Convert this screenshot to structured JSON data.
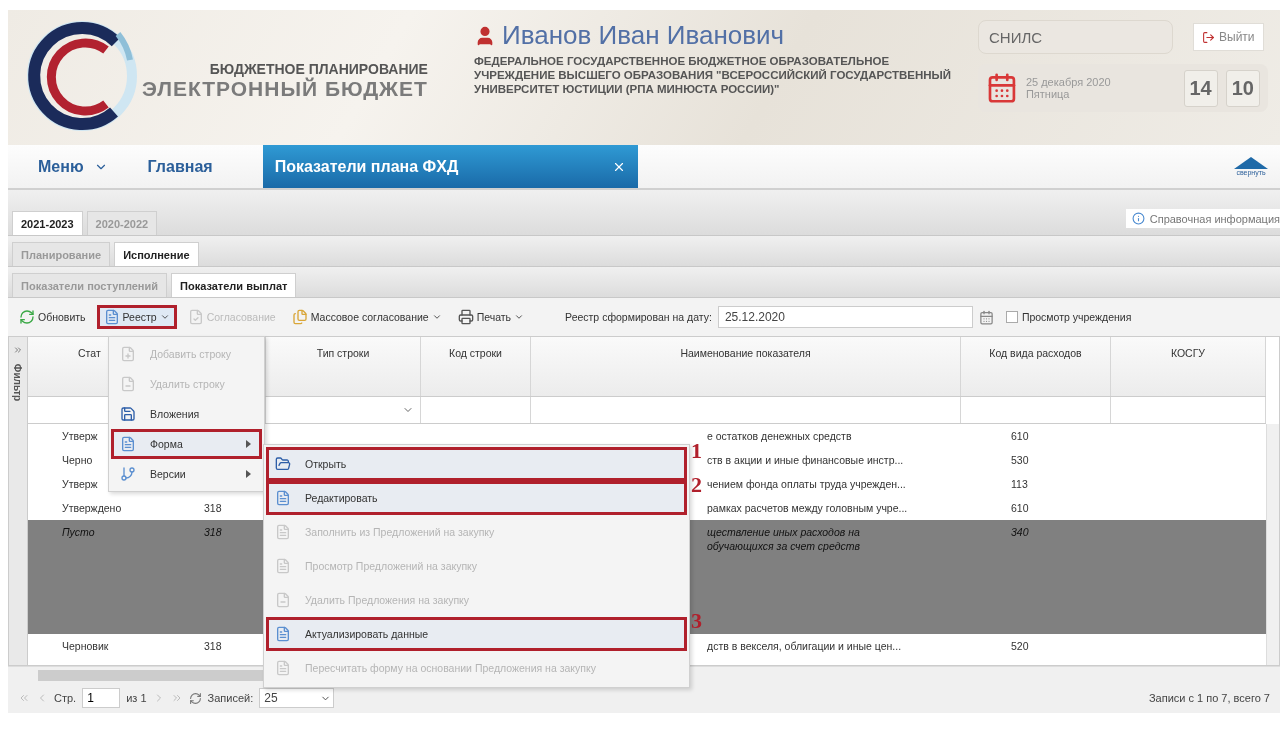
{
  "header": {
    "logo_top": "БЮДЖЕТНОЕ ПЛАНИРОВАНИЕ",
    "logo_bottom": "ЭЛЕКТРОННЫЙ БЮДЖЕТ",
    "user_name": "Иванов Иван Иванович",
    "organization": "ФЕДЕРАЛЬНОЕ ГОСУДАРСТВЕННОЕ БЮДЖЕТНОЕ ОБРАЗОВАТЕЛЬНОЕ УЧРЕЖДЕНИЕ ВЫСШЕГО ОБРАЗОВАНИЯ \"ВСЕРОССИЙСКИЙ ГОСУДАРСТВЕННЫЙ УНИВЕРСИТЕТ ЮСТИЦИИ (РПА МИНЮСТА РОССИИ)\"",
    "snils_placeholder": "СНИЛС",
    "logout": "Выйти",
    "date": "25 декабря 2020",
    "weekday": "Пятница",
    "hours": "14",
    "minutes": "10"
  },
  "nav": {
    "menu": "Меню",
    "home": "Главная",
    "tabs": [
      {
        "label": "Показатели плана ФХД",
        "selected": true
      }
    ],
    "collapse": "свернуть"
  },
  "period_tabs": [
    {
      "label": "2021-2023",
      "selected": true
    },
    {
      "label": "2020-2022",
      "selected": false
    }
  ],
  "help_link": "Справочная информация",
  "mode_tabs": [
    {
      "label": "Планирование",
      "selected": false
    },
    {
      "label": "Исполнение",
      "selected": true
    }
  ],
  "section_tabs": [
    {
      "label": "Показатели поступлений",
      "selected": false
    },
    {
      "label": "Показатели выплат",
      "selected": true
    }
  ],
  "toolbar": {
    "buttons": [
      {
        "label": "Обновить",
        "kind": "refresh",
        "disabled": false,
        "dropdown": false,
        "highlighted": false
      },
      {
        "label": "Реестр",
        "kind": "registry",
        "disabled": false,
        "dropdown": true,
        "highlighted": true
      },
      {
        "label": "Согласование",
        "kind": "approve",
        "disabled": true,
        "dropdown": false,
        "highlighted": false
      },
      {
        "label": "Массовое согласование",
        "kind": "mass",
        "disabled": false,
        "dropdown": true,
        "highlighted": false
      },
      {
        "label": "Печать",
        "kind": "print",
        "disabled": false,
        "dropdown": true,
        "highlighted": false
      }
    ],
    "date_label": "Реестр сформирован на дату:",
    "date_value": "25.12.2020",
    "institution_view": {
      "label": "Просмотр учреждения",
      "checked": false
    }
  },
  "filter_panel": {
    "label": "Фильтр"
  },
  "grid": {
    "header": {
      "status": "Стат",
      "type": "Тип строки",
      "code": "Код строки",
      "name": "Наименование показателя",
      "expense_code": "Код вида расходов",
      "kosgu": "КОСГУ"
    },
    "rows": [
      {
        "status": "Утверж",
        "name": "е остатков денежных средств",
        "expense_code": "610",
        "overlaid": true,
        "selected": false
      },
      {
        "status": "Черно",
        "name": "ств в акции и иные финансовые инстр...",
        "expense_code": "530",
        "overlaid": true,
        "selected": false
      },
      {
        "status": "Утверж",
        "name": "чением фонда оплаты труда учрежден...",
        "expense_code": "113",
        "overlaid": true,
        "selected": false
      },
      {
        "status": "Утверждено",
        "column_2": "318",
        "name": "рамках расчетов между головным учре...",
        "expense_code": "610",
        "overlaid": true,
        "selected": false
      },
      {
        "status": "Пусто",
        "column_2": "318",
        "name": "ществление иных расходов на обучающихся за счет средств",
        "expense_code": "340",
        "overlaid": true,
        "selected": true
      },
      {
        "status": "Черновик",
        "column_2": "318",
        "name": "дств в векселя, облигации и иные цен...",
        "expense_code": "520",
        "overlaid": true,
        "selected": false
      }
    ]
  },
  "registry_menu": {
    "items": [
      {
        "label": "Добавить строку",
        "kind": "add",
        "disabled": true,
        "submenu": false,
        "highlighted": false
      },
      {
        "label": "Удалить строку",
        "kind": "delete",
        "disabled": true,
        "submenu": false,
        "highlighted": false
      },
      {
        "label": "Вложения",
        "kind": "attach",
        "disabled": false,
        "submenu": false,
        "highlighted": false
      },
      {
        "label": "Форма",
        "kind": "form",
        "disabled": false,
        "submenu": true,
        "highlighted": true
      },
      {
        "label": "Версии",
        "kind": "versions",
        "disabled": false,
        "submenu": true,
        "highlighted": false
      }
    ]
  },
  "form_submenu": {
    "items": [
      {
        "label": "Открыть",
        "kind": "open",
        "disabled": false,
        "highlighted": true,
        "annotation": "1"
      },
      {
        "label": "Редактировать",
        "kind": "form",
        "disabled": false,
        "highlighted": true,
        "annotation": "2"
      },
      {
        "label": "Заполнить из Предложений на закупку",
        "kind": "form",
        "disabled": true,
        "highlighted": false
      },
      {
        "label": "Просмотр Предложений на закупку",
        "kind": "form",
        "disabled": true,
        "highlighted": false
      },
      {
        "label": "Удалить Предложения на закупку",
        "kind": "delete",
        "disabled": true,
        "highlighted": false
      },
      {
        "label": "Актуализировать данные",
        "kind": "form",
        "disabled": false,
        "highlighted": true,
        "annotation": "3"
      },
      {
        "label": "Пересчитать форму на основании Предложения на закупку",
        "kind": "form",
        "disabled": true,
        "highlighted": false
      }
    ]
  },
  "pager": {
    "page_label": "Стр.",
    "page": "1",
    "of": "из 1",
    "page_size_label": "Записей:",
    "page_size": "25",
    "summary": "Записи с 1 по 7, всего 7"
  }
}
